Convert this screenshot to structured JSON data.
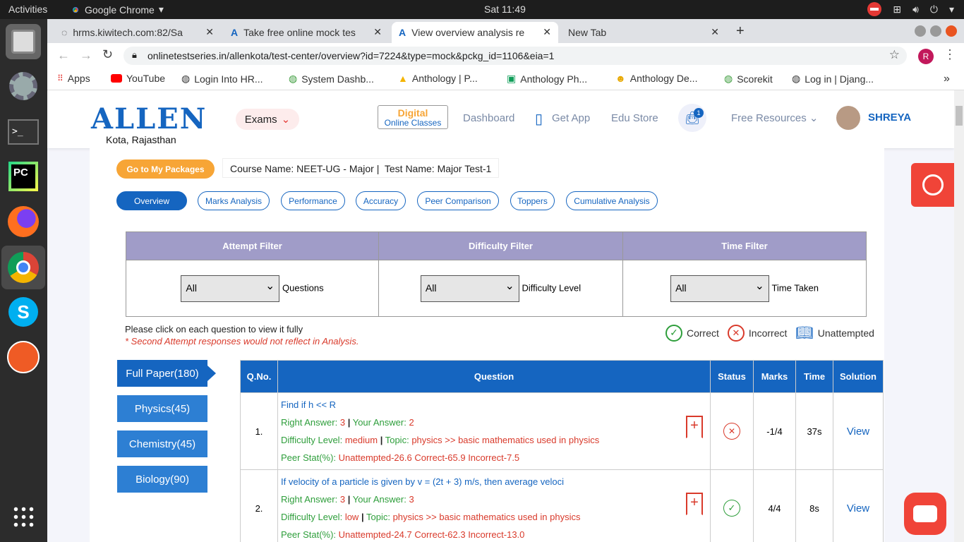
{
  "system": {
    "activities": "Activities",
    "app_name": "Google Chrome",
    "clock": "Sat 11:49"
  },
  "tabs": [
    {
      "title": "hrms.kiwitech.com:82/Sa"
    },
    {
      "title": "Take free online mock tes"
    },
    {
      "title": "View overview analysis re"
    },
    {
      "title": "New Tab"
    }
  ],
  "url": "onlinetestseries.in/allenkota/test-center/overview?id=7224&type=mock&pckg_id=1106&eia=1",
  "profile_initial": "R",
  "bookmarks": [
    "Apps",
    "YouTube",
    "Login Into HR...",
    "System Dashb...",
    "Anthology | P...",
    "Anthology Ph...",
    "Anthology De...",
    "Scorekit",
    "Log in | Djang..."
  ],
  "site": {
    "logo": "ALLEN",
    "logo_sub": "Kota, Rajasthan",
    "exams": "Exams",
    "digital_title": "Digital",
    "digital_sub": "Online Classes",
    "nav": [
      "Dashboard",
      "Get App",
      "Edu Store"
    ],
    "cart_count": "1",
    "free_resources": "Free Resources",
    "user": "SHREYA"
  },
  "course": {
    "btn": "Go to My Packages",
    "info": "Course Name: NEET-UG - Major |  Test Name: Major Test-1"
  },
  "analysis_tabs": [
    "Overview",
    "Marks Analysis",
    "Performance",
    "Accuracy",
    "Peer Comparison",
    "Toppers",
    "Cumulative Analysis"
  ],
  "filters": [
    {
      "head": "Attempt Filter",
      "value": "All",
      "label": "Questions"
    },
    {
      "head": "Difficulty Filter",
      "value": "All",
      "label": "Difficulty Level"
    },
    {
      "head": "Time Filter",
      "value": "All",
      "label": "Time Taken"
    }
  ],
  "notes": {
    "click": "Please click on each question to view it fully",
    "warn": "* Second Attempt responses would not reflect in Analysis."
  },
  "legend": {
    "correct": "Correct",
    "incorrect": "Incorrect",
    "unattempted": "Unattempted"
  },
  "subjects": [
    "Full Paper(180)",
    "Physics(45)",
    "Chemistry(45)",
    "Biology(90)"
  ],
  "table": {
    "headers": [
      "Q.No.",
      "Question",
      "Status",
      "Marks",
      "Time",
      "Solution"
    ],
    "rows": [
      {
        "no": "1.",
        "title": "Find  if h << R",
        "right_label": "Right Answer:",
        "right": "3",
        "your_label": "Your Answer:",
        "your": "2",
        "diff_label": "Difficulty Level:",
        "diff": "medium",
        "topic_label": "Topic:",
        "topic": "physics >> basic mathematics used in physics",
        "peer_label": "Peer Stat(%):",
        "peer": "Unattempted-26.6 Correct-65.9 Incorrect-7.5",
        "status": "incorrect",
        "marks": "-1/4",
        "time": "37s",
        "solution": "View"
      },
      {
        "no": "2.",
        "title": "If velocity of a particle is given by v = (2t + 3) m/s, then average veloci",
        "right_label": "Right Answer:",
        "right": "3",
        "your_label": "Your Answer:",
        "your": "3",
        "diff_label": "Difficulty Level:",
        "diff": "low",
        "topic_label": "Topic:",
        "topic": "physics >> basic mathematics used in physics",
        "peer_label": "Peer Stat(%):",
        "peer": "Unattempted-24.7 Correct-62.3 Incorrect-13.0",
        "status": "correct",
        "marks": "4/4",
        "time": "8s",
        "solution": "View"
      }
    ]
  },
  "colors": {
    "brand": "#1565c0",
    "accent": "#f7a536",
    "correct": "#2e9e3b",
    "incorrect": "#d93a2b",
    "filter_head": "#a09cc8",
    "support": "#f04438"
  }
}
